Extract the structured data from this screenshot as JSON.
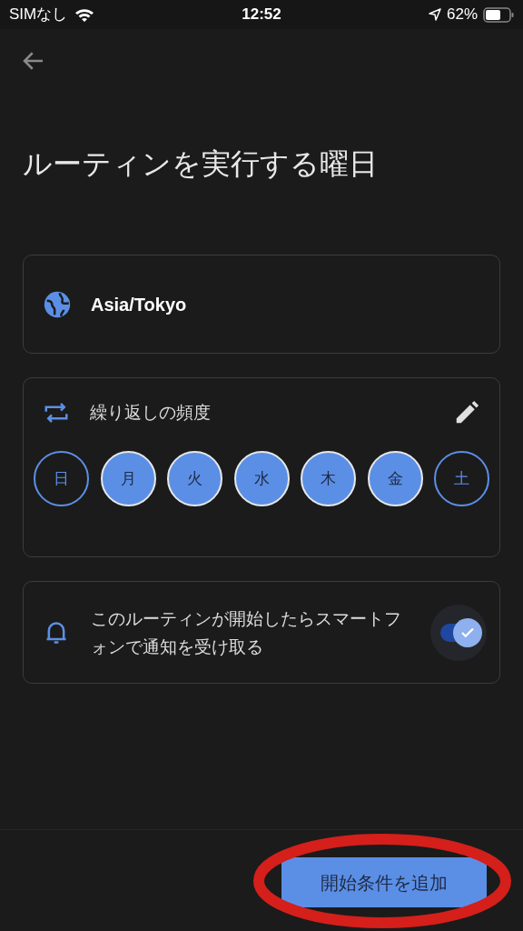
{
  "status_bar": {
    "carrier": "SIMなし",
    "time": "12:52",
    "battery": "62%"
  },
  "title": "ルーティンを実行する曜日",
  "timezone": {
    "label": "Asia/Tokyo"
  },
  "repeat": {
    "label": "繰り返しの頻度",
    "days": [
      {
        "label": "日",
        "selected": false
      },
      {
        "label": "月",
        "selected": true
      },
      {
        "label": "火",
        "selected": true
      },
      {
        "label": "水",
        "selected": true
      },
      {
        "label": "木",
        "selected": true
      },
      {
        "label": "金",
        "selected": true
      },
      {
        "label": "土",
        "selected": false
      }
    ]
  },
  "notify": {
    "label": "このルーティンが開始したらスマートフォンで通知を受け取る",
    "on": true
  },
  "add_button": {
    "label": "開始条件を追加"
  },
  "annotation": {
    "kind": "ellipse",
    "color": "#d41f1a"
  }
}
